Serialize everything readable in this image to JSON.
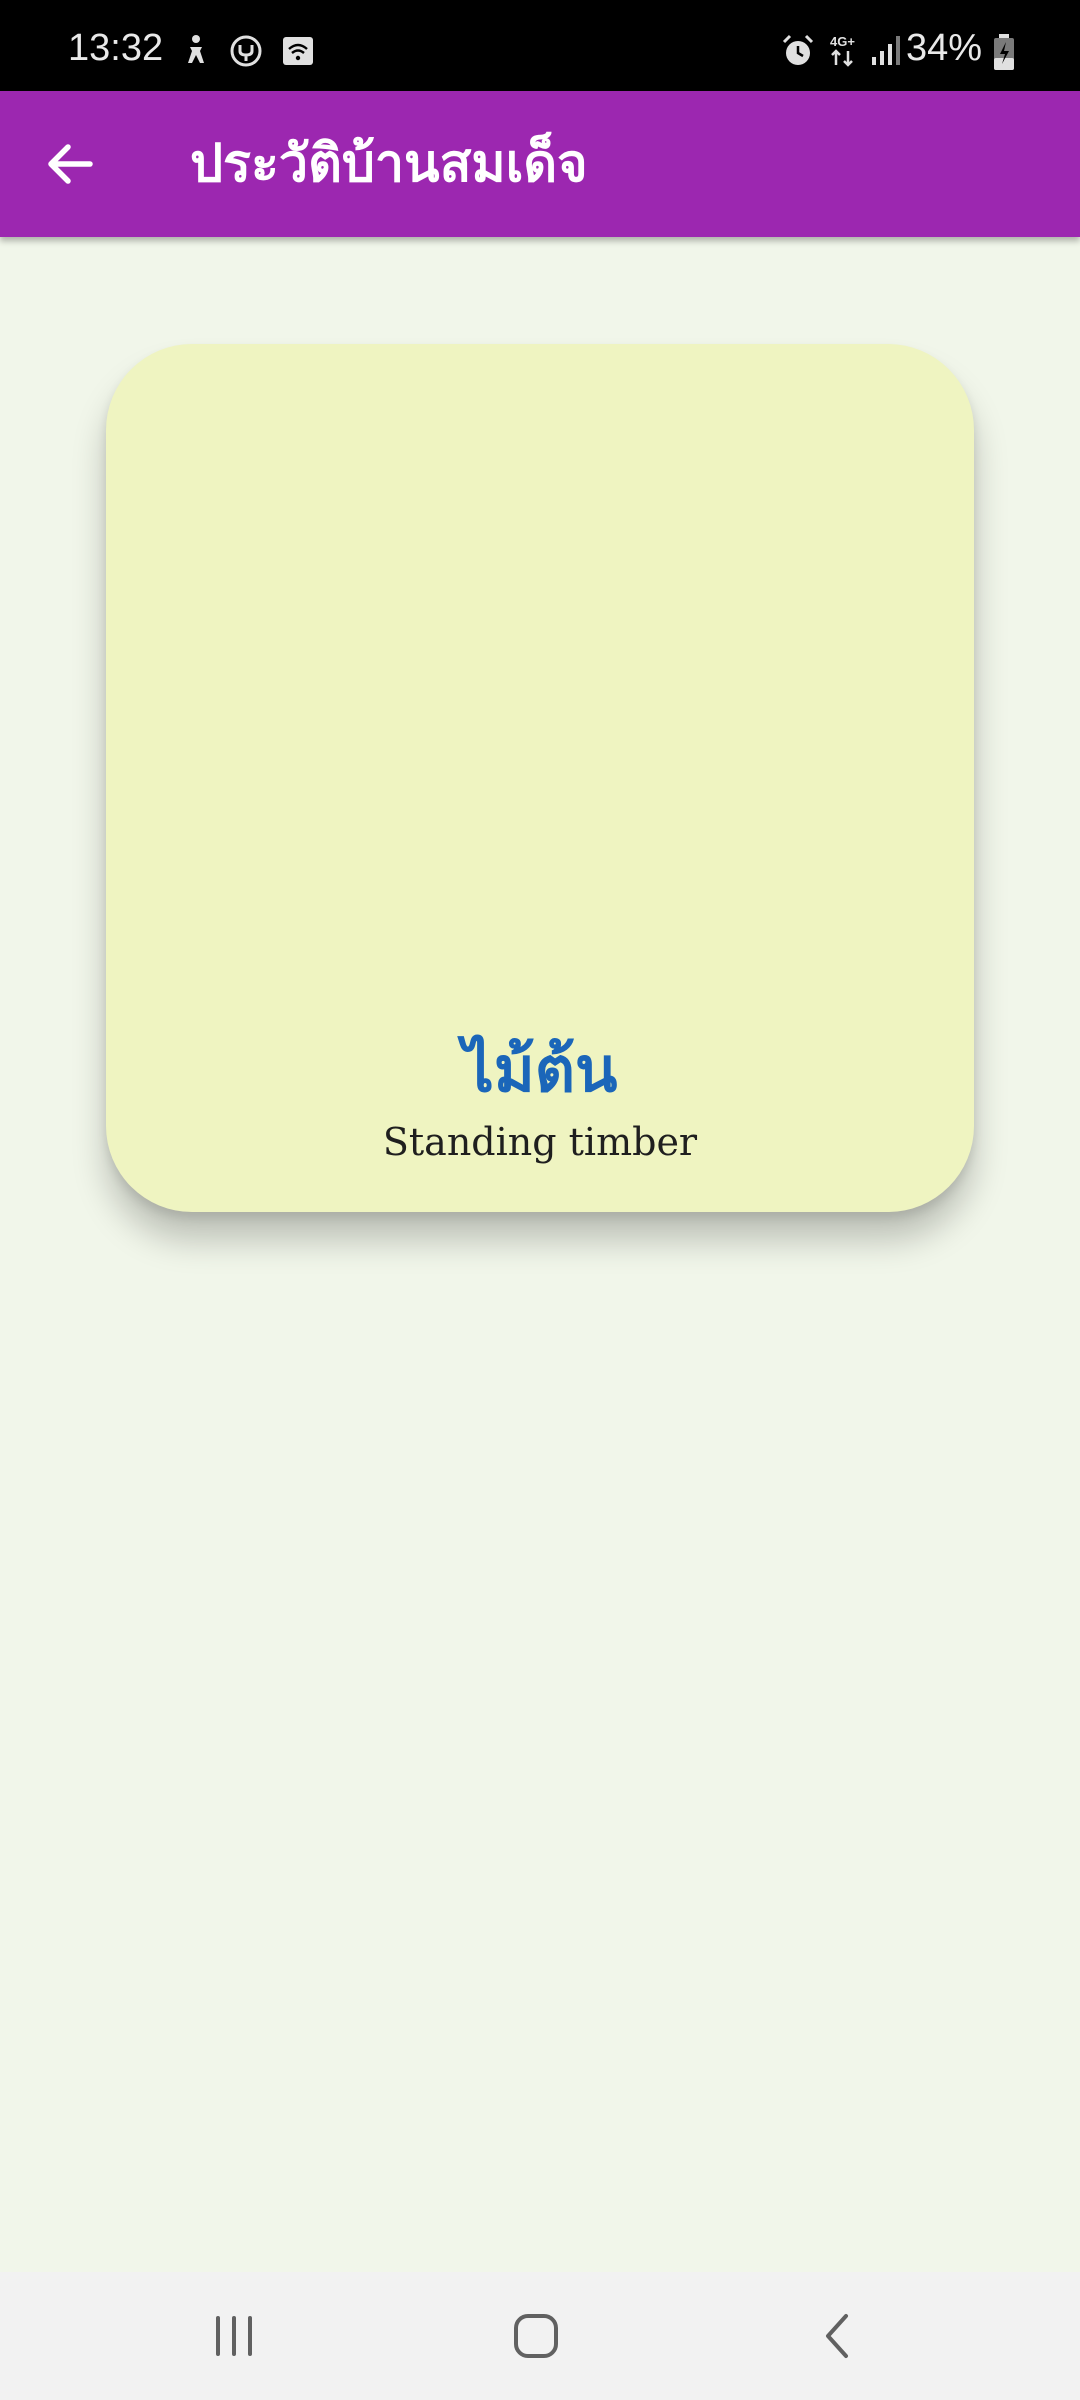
{
  "status_bar": {
    "time": "13:32",
    "battery_percent": "34%",
    "network_type": "4G+",
    "icons": [
      "accessibility-icon",
      "vpn-icon",
      "cast-icon",
      "alarm-icon",
      "network-4g-icon",
      "signal-icon",
      "battery-charging-icon"
    ]
  },
  "app_bar": {
    "title": "ประวัติบ้านสมเด็จ",
    "background_color": "#9c27b0",
    "back_icon": "arrow-left-icon"
  },
  "card": {
    "title": "ไม้ต้น",
    "subtitle": "Standing timber",
    "title_color": "#1b66b9",
    "background_color": "#eff4c1"
  },
  "nav_bar": {
    "icons": [
      "recent-apps-icon",
      "home-icon",
      "back-icon"
    ]
  }
}
